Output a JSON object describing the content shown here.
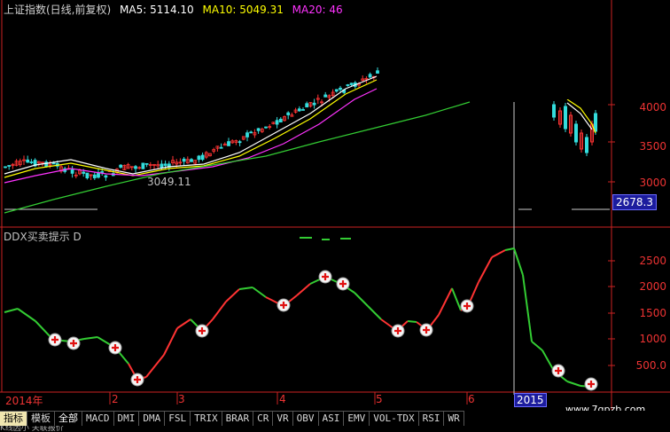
{
  "header": {
    "title": "上证指数(日线,前复权)",
    "ma5": "MA5: 5114.10",
    "ma10": "MA10: 5049.31",
    "ma20": "MA20: 46"
  },
  "colors": {
    "ma5": "#ffffff",
    "ma10": "#ffff00",
    "ma20": "#ff33ff",
    "ma60": "#33cc33",
    "up": "#ff3333",
    "down": "#33cc33",
    "axis": "#cc2222"
  },
  "price_axis": [
    "4000",
    "3500",
    "3000"
  ],
  "price_tag": "2678.3",
  "low_label": "3049.11",
  "subchart": {
    "title": "DDX买卖提示 D",
    "axis": [
      "2500",
      "2000",
      "1500",
      "1000",
      "500.0"
    ]
  },
  "dates": [
    "2014年",
    "2",
    "3",
    "4",
    "5",
    "6",
    "2015"
  ],
  "toolbar": [
    "指标",
    "模板",
    "全部",
    "MACD",
    "DMI",
    "DMA",
    "FSL",
    "TRIX",
    "BRAR",
    "CR",
    "VR",
    "OBV",
    "ASI",
    "EMV",
    "VOL-TDX",
    "RSI",
    "WR"
  ],
  "watermark": "www.7gpzb.com",
  "bottom_text": "K线因小 关联报价"
}
